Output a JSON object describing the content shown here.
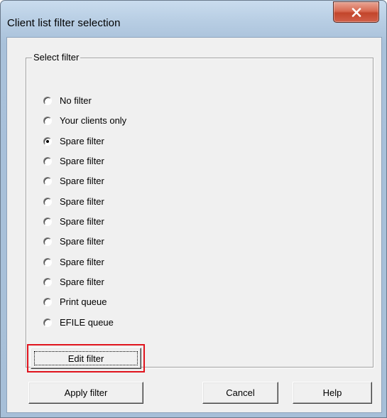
{
  "window": {
    "title": "Client list filter selection"
  },
  "group": {
    "legend": "Select filter",
    "options": [
      {
        "label": "No filter",
        "checked": false
      },
      {
        "label": "Your clients only",
        "checked": false
      },
      {
        "label": "Spare filter",
        "checked": true
      },
      {
        "label": "Spare filter",
        "checked": false
      },
      {
        "label": "Spare filter",
        "checked": false
      },
      {
        "label": "Spare filter",
        "checked": false
      },
      {
        "label": "Spare filter",
        "checked": false
      },
      {
        "label": "Spare filter",
        "checked": false
      },
      {
        "label": "Spare filter",
        "checked": false
      },
      {
        "label": "Spare filter",
        "checked": false
      },
      {
        "label": "Print queue",
        "checked": false
      },
      {
        "label": "EFILE queue",
        "checked": false
      }
    ]
  },
  "buttons": {
    "edit_filter": "Edit filter",
    "apply_filter": "Apply filter",
    "cancel": "Cancel",
    "help": "Help"
  },
  "colors": {
    "highlight_border": "#e0141d",
    "close_button": "#c2452b"
  }
}
